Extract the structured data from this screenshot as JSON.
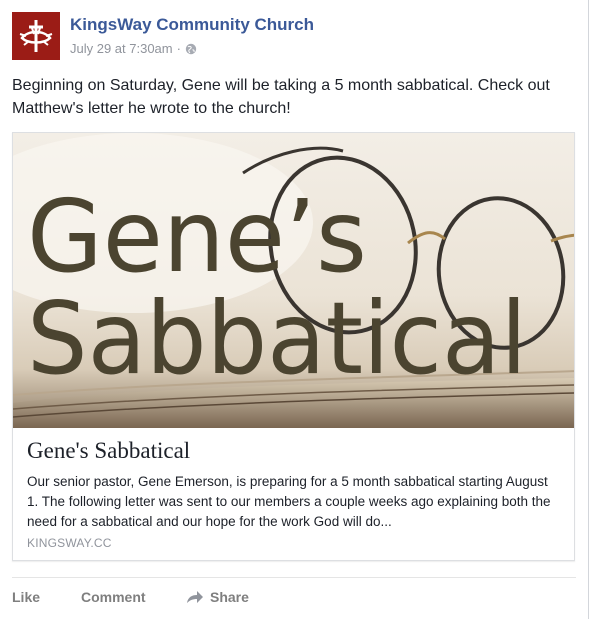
{
  "post": {
    "page_name": "KingsWay Community Church",
    "timestamp": "July 29 at 7:30am",
    "separator": "·",
    "audience_icon": "globe-icon",
    "text": "Beginning on Saturday, Gene will be taking a 5 month sabbatical. Check out Matthew's letter he wrote to the church!"
  },
  "link_card": {
    "image_text_line1": "Gene’s",
    "image_text_line2": "Sabbatical",
    "title": "Gene's Sabbatical",
    "description": "Our senior pastor, Gene Emerson, is preparing for a 5 month sabbatical starting August 1. The following letter was sent to our members a couple weeks ago explaining both the need for a sabbatical and our hope for the work God will do...",
    "domain": "KINGSWAY.CC"
  },
  "actions": {
    "like": "Like",
    "comment": "Comment",
    "share": "Share",
    "share_icon": "share-arrow-icon"
  },
  "colors": {
    "page_name": "#3b5998",
    "avatar_bg": "#9b1c16",
    "meta_text": "#90949c",
    "action_text": "#7f7f7f"
  }
}
